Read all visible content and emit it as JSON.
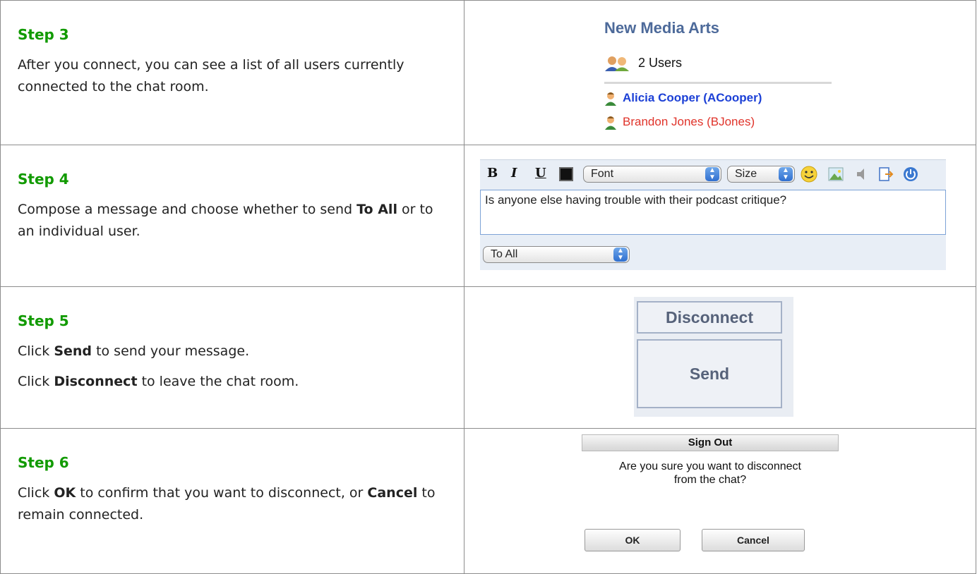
{
  "steps": [
    {
      "title": "Step 3",
      "paragraphs": [
        {
          "parts": [
            {
              "text": "After you connect, you can see a list of all users currently connected to the chat room."
            }
          ]
        }
      ]
    },
    {
      "title": "Step 4",
      "paragraphs": [
        {
          "parts": [
            {
              "text": "Compose a message and choose whether to send "
            },
            {
              "text": "To All",
              "bold": true
            },
            {
              "text": " or to an individual user."
            }
          ]
        }
      ]
    },
    {
      "title": "Step 5",
      "paragraphs": [
        {
          "parts": [
            {
              "text": "Click "
            },
            {
              "text": "Send",
              "bold": true
            },
            {
              "text": " to send your message."
            }
          ]
        },
        {
          "parts": [
            {
              "text": "Click "
            },
            {
              "text": "Disconnect",
              "bold": true
            },
            {
              "text": " to leave the chat room."
            }
          ]
        }
      ]
    },
    {
      "title": "Step 6",
      "paragraphs": [
        {
          "parts": [
            {
              "text": "Click "
            },
            {
              "text": "OK",
              "bold": true
            },
            {
              "text": " to confirm that you want to disconnect, or "
            },
            {
              "text": "Cancel",
              "bold": true
            },
            {
              "text": " to remain connected."
            }
          ]
        }
      ]
    }
  ],
  "userlist": {
    "room_title": "New Media Arts",
    "users_count_label": "2 Users",
    "users": [
      {
        "name": "Alicia Cooper (ACooper)",
        "color": "#1c40d6"
      },
      {
        "name": "Brandon Jones (BJones)",
        "color": "#e0332a"
      }
    ]
  },
  "composer": {
    "bold_label": "B",
    "italic_label": "I",
    "underline_label": "U",
    "font_select": "Font",
    "size_select": "Size",
    "message_text": "Is anyone else having trouble with their podcast critique?",
    "recipient_select": "To All",
    "icons": [
      "smiley-icon",
      "image-icon",
      "speaker-icon",
      "export-icon",
      "power-icon"
    ]
  },
  "buttons": {
    "disconnect_label": "Disconnect",
    "send_label": "Send"
  },
  "dialog": {
    "title": "Sign Out",
    "message_line1": "Are you sure you want to disconnect",
    "message_line2": "from the chat?",
    "ok_label": "OK",
    "cancel_label": "Cancel"
  },
  "colors": {
    "step_title": "#119a00",
    "room_title": "#4d6a9a",
    "button_text": "#56627a"
  }
}
